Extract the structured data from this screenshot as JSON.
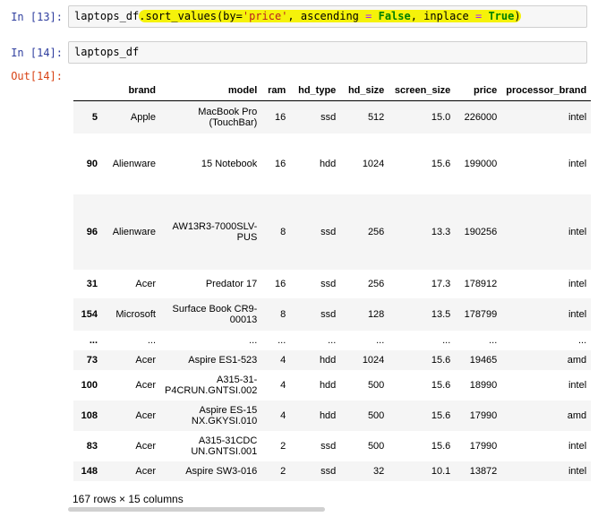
{
  "cells": [
    {
      "prompt": "In [13]:",
      "code_tokens": {
        "var": "laptops_df",
        "method": ".sort_values(by=",
        "arg1": "'price'",
        "sep1": ", ascending ",
        "eq1": "=",
        "val1": "False",
        "sep2": ", inplace ",
        "eq2": "=",
        "val2": "True",
        "close": ")"
      }
    },
    {
      "prompt": "In [14]:",
      "code": "laptops_df"
    },
    {
      "prompt": "Out[14]:"
    }
  ],
  "dataframe": {
    "columns": [
      "brand",
      "model",
      "ram",
      "hd_type",
      "hd_size",
      "screen_size",
      "price",
      "processor_brand"
    ],
    "rows": [
      {
        "index": "5",
        "brand": "Apple",
        "model": "MacBook Pro (TouchBar)",
        "ram": "16",
        "hd_type": "ssd",
        "hd_size": "512",
        "screen_size": "15.0",
        "price": "226000",
        "processor_brand": "intel"
      },
      {
        "index": "90",
        "brand": "Alienware",
        "model": "15 Notebook",
        "ram": "16",
        "hd_type": "hdd",
        "hd_size": "1024",
        "screen_size": "15.6",
        "price": "199000",
        "processor_brand": "intel"
      },
      {
        "index": "96",
        "brand": "Alienware",
        "model": "AW13R3-7000SLV-PUS",
        "ram": "8",
        "hd_type": "ssd",
        "hd_size": "256",
        "screen_size": "13.3",
        "price": "190256",
        "processor_brand": "intel"
      },
      {
        "index": "31",
        "brand": "Acer",
        "model": "Predator 17",
        "ram": "16",
        "hd_type": "ssd",
        "hd_size": "256",
        "screen_size": "17.3",
        "price": "178912",
        "processor_brand": "intel"
      },
      {
        "index": "154",
        "brand": "Microsoft",
        "model": "Surface Book CR9-00013",
        "ram": "8",
        "hd_type": "ssd",
        "hd_size": "128",
        "screen_size": "13.5",
        "price": "178799",
        "processor_brand": "intel"
      },
      {
        "index": "...",
        "brand": "...",
        "model": "...",
        "ram": "...",
        "hd_type": "...",
        "hd_size": "...",
        "screen_size": "...",
        "price": "...",
        "processor_brand": "..."
      },
      {
        "index": "73",
        "brand": "Acer",
        "model": "Aspire ES1-523",
        "ram": "4",
        "hd_type": "hdd",
        "hd_size": "1024",
        "screen_size": "15.6",
        "price": "19465",
        "processor_brand": "amd"
      },
      {
        "index": "100",
        "brand": "Acer",
        "model": "A315-31-P4CRUN.GNTSI.002",
        "ram": "4",
        "hd_type": "hdd",
        "hd_size": "500",
        "screen_size": "15.6",
        "price": "18990",
        "processor_brand": "intel"
      },
      {
        "index": "108",
        "brand": "Acer",
        "model": "Aspire ES-15 NX.GKYSI.010",
        "ram": "4",
        "hd_type": "hdd",
        "hd_size": "500",
        "screen_size": "15.6",
        "price": "17990",
        "processor_brand": "amd"
      },
      {
        "index": "83",
        "brand": "Acer",
        "model": "A315-31CDC UN.GNTSI.001",
        "ram": "2",
        "hd_type": "ssd",
        "hd_size": "500",
        "screen_size": "15.6",
        "price": "17990",
        "processor_brand": "intel"
      },
      {
        "index": "148",
        "brand": "Acer",
        "model": "Aspire SW3-016",
        "ram": "2",
        "hd_type": "ssd",
        "hd_size": "32",
        "screen_size": "10.1",
        "price": "13872",
        "processor_brand": "intel"
      }
    ],
    "footer": "167 rows × 15 columns"
  }
}
